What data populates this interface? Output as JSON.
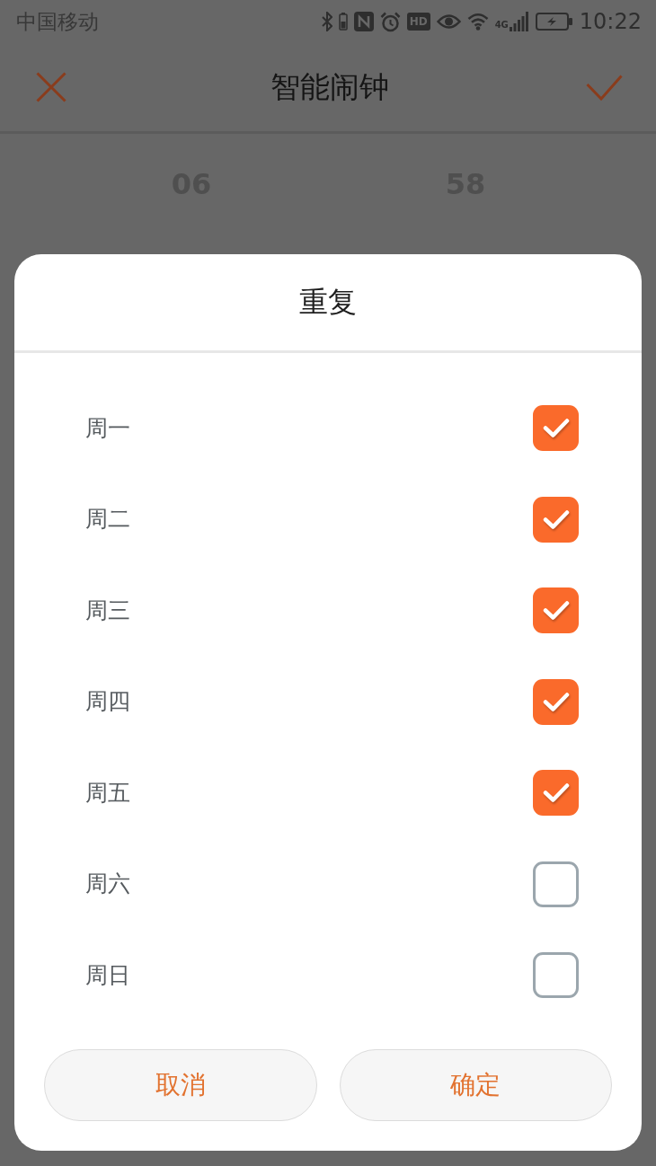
{
  "status_bar": {
    "carrier": "中国移动",
    "hd_badge": "HD",
    "network": "4G",
    "time": "10:22"
  },
  "header": {
    "title": "智能闹钟"
  },
  "time_picker": {
    "hour": "06",
    "minute": "58"
  },
  "dialog": {
    "title": "重复",
    "days": [
      {
        "label": "周一",
        "checked": true
      },
      {
        "label": "周二",
        "checked": true
      },
      {
        "label": "周三",
        "checked": true
      },
      {
        "label": "周四",
        "checked": true
      },
      {
        "label": "周五",
        "checked": true
      },
      {
        "label": "周六",
        "checked": false
      },
      {
        "label": "周日",
        "checked": false
      }
    ],
    "buttons": [
      "取消",
      "确定"
    ]
  }
}
